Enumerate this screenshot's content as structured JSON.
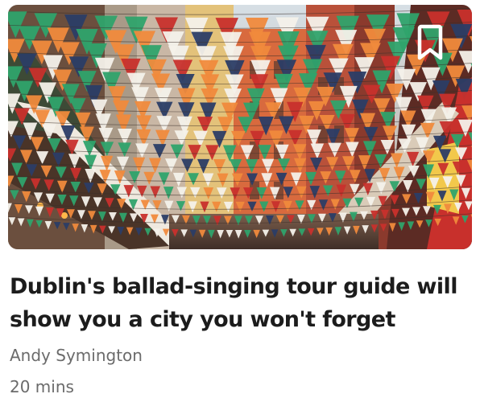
{
  "article": {
    "title": "Dublin's ballad-singing tour guide will show you a city you won't forget",
    "author": "Andy Symington",
    "duration": "20 mins"
  },
  "hero": {
    "subject": "street-with-bunting-flags-photo",
    "colors": {
      "orange": "#f08a3c",
      "green": "#2fa36b",
      "white": "#f4f1ea",
      "navy": "#2b3d66",
      "red": "#c8302c",
      "sky": "#cfd8df"
    }
  },
  "bookmark": {
    "icon": "bookmark-icon"
  }
}
